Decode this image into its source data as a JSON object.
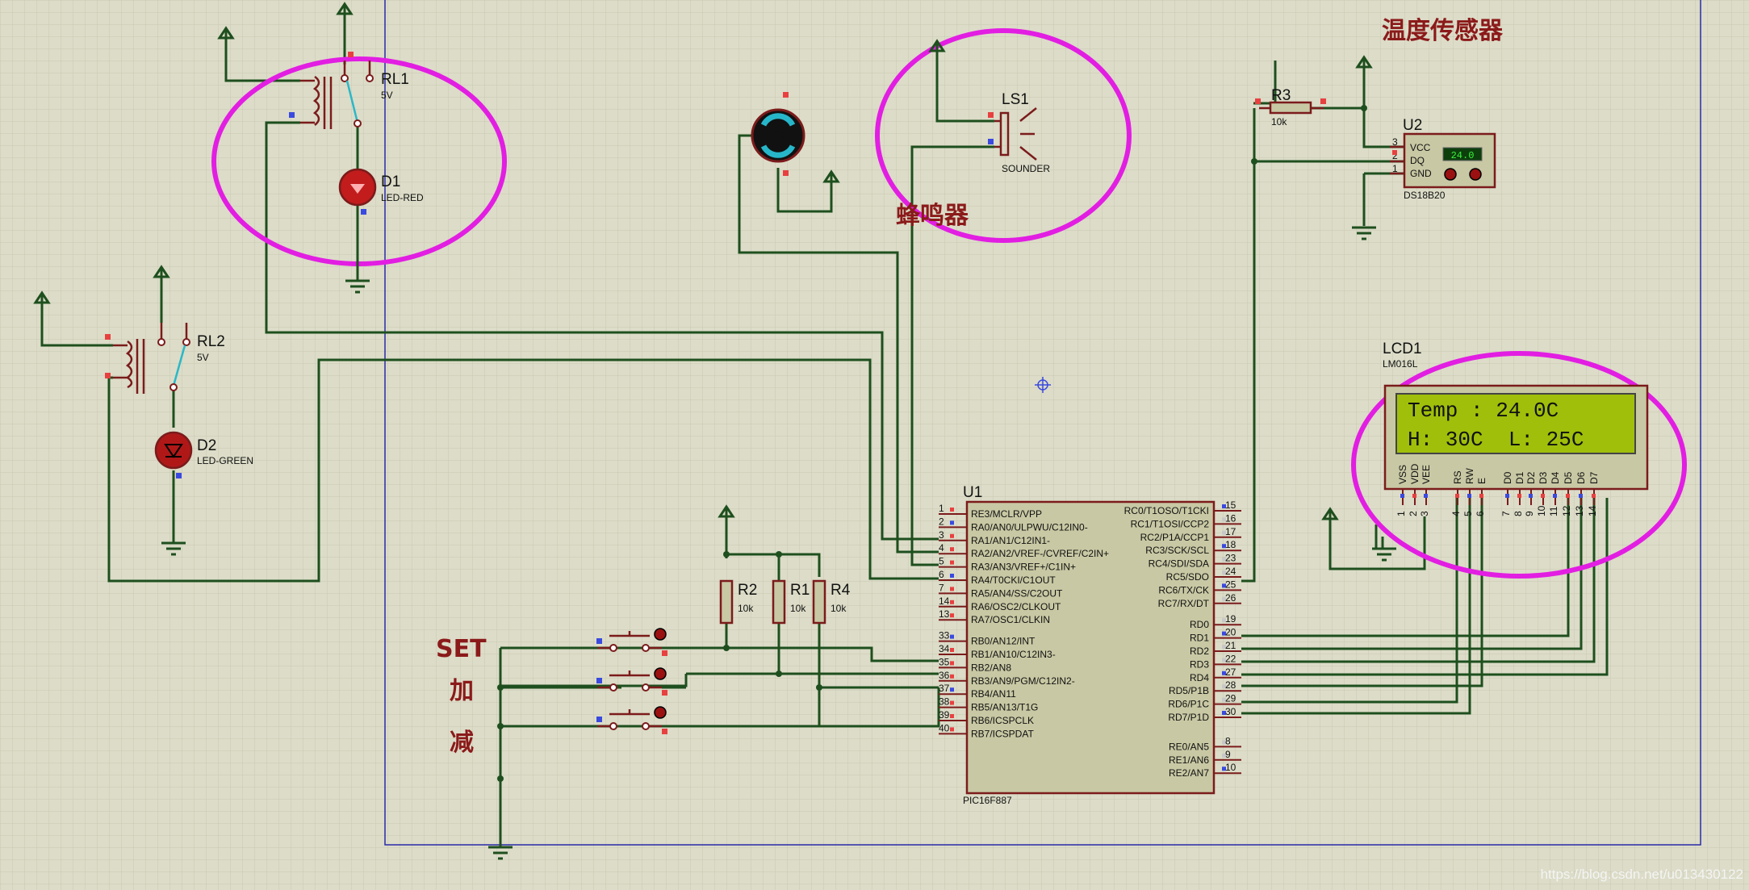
{
  "labels": {
    "temp_sensor_title": "温度传感器",
    "buzzer_title": "蜂鸣器",
    "set_label": "SET",
    "plus_label": "加",
    "minus_label": "减",
    "watermark": "https://blog.csdn.net/u013430122"
  },
  "components": {
    "rl1": {
      "ref": "RL1",
      "value": "5V"
    },
    "rl2": {
      "ref": "RL2",
      "value": "5V"
    },
    "d1": {
      "ref": "D1",
      "value": "LED-RED"
    },
    "d2": {
      "ref": "D2",
      "value": "LED-GREEN"
    },
    "ls1": {
      "ref": "LS1",
      "value": "SOUNDER"
    },
    "r1": {
      "ref": "R1",
      "value": "10k"
    },
    "r2": {
      "ref": "R2",
      "value": "10k"
    },
    "r3": {
      "ref": "R3",
      "value": "10k"
    },
    "r4": {
      "ref": "R4",
      "value": "10k"
    },
    "u1": {
      "ref": "U1",
      "part": "PIC16F887"
    },
    "u2": {
      "ref": "U2",
      "part": "DS18B20",
      "reading": "24.0",
      "pins": [
        "VCC",
        "DQ",
        "GND"
      ],
      "pin_nums": [
        "3",
        "2",
        "1"
      ]
    },
    "lcd1": {
      "ref": "LCD1",
      "part": "LM016L",
      "line1": "Temp : 24.0C",
      "line2": "H: 30C  L: 25C",
      "pins": [
        "VSS",
        "VDD",
        "VEE",
        "RS",
        "RW",
        "E",
        "D0",
        "D1",
        "D2",
        "D3",
        "D4",
        "D5",
        "D6",
        "D7"
      ],
      "pin_nums": [
        "1",
        "2",
        "3",
        "4",
        "5",
        "6",
        "7",
        "8",
        "9",
        "10",
        "11",
        "12",
        "13",
        "14"
      ]
    }
  },
  "u1_left_pins": [
    {
      "num": "1",
      "name": "RE3/MCLR/VPP"
    },
    {
      "num": "2",
      "name": "RA0/AN0/ULPWU/C12IN0-"
    },
    {
      "num": "3",
      "name": "RA1/AN1/C12IN1-"
    },
    {
      "num": "4",
      "name": "RA2/AN2/VREF-/CVREF/C2IN+"
    },
    {
      "num": "5",
      "name": "RA3/AN3/VREF+/C1IN+"
    },
    {
      "num": "6",
      "name": "RA4/T0CKI/C1OUT"
    },
    {
      "num": "7",
      "name": "RA5/AN4/SS/C2OUT"
    },
    {
      "num": "14",
      "name": "RA6/OSC2/CLKOUT"
    },
    {
      "num": "13",
      "name": "RA7/OSC1/CLKIN"
    },
    {
      "num": "33",
      "name": "RB0/AN12/INT"
    },
    {
      "num": "34",
      "name": "RB1/AN10/C12IN3-"
    },
    {
      "num": "35",
      "name": "RB2/AN8"
    },
    {
      "num": "36",
      "name": "RB3/AN9/PGM/C12IN2-"
    },
    {
      "num": "37",
      "name": "RB4/AN11"
    },
    {
      "num": "38",
      "name": "RB5/AN13/T1G"
    },
    {
      "num": "39",
      "name": "RB6/ICSPCLK"
    },
    {
      "num": "40",
      "name": "RB7/ICSPDAT"
    }
  ],
  "u1_right_pins": [
    {
      "num": "15",
      "name": "RC0/T1OSO/T1CKI"
    },
    {
      "num": "16",
      "name": "RC1/T1OSI/CCP2"
    },
    {
      "num": "17",
      "name": "RC2/P1A/CCP1"
    },
    {
      "num": "18",
      "name": "RC3/SCK/SCL"
    },
    {
      "num": "23",
      "name": "RC4/SDI/SDA"
    },
    {
      "num": "24",
      "name": "RC5/SDO"
    },
    {
      "num": "25",
      "name": "RC6/TX/CK"
    },
    {
      "num": "26",
      "name": "RC7/RX/DT"
    },
    {
      "num": "19",
      "name": "RD0"
    },
    {
      "num": "20",
      "name": "RD1"
    },
    {
      "num": "21",
      "name": "RD2"
    },
    {
      "num": "22",
      "name": "RD3"
    },
    {
      "num": "27",
      "name": "RD4"
    },
    {
      "num": "28",
      "name": "RD5/P1B"
    },
    {
      "num": "29",
      "name": "RD6/P1C"
    },
    {
      "num": "30",
      "name": "RD7/P1D"
    },
    {
      "num": "8",
      "name": "RE0/AN5"
    },
    {
      "num": "9",
      "name": "RE1/AN6"
    },
    {
      "num": "10",
      "name": "RE2/AN7"
    }
  ],
  "colors": {
    "background": "#dcdcc8",
    "wire": "#1e4f1e",
    "component": "#7b1b1b",
    "highlight": "#e21ee2",
    "lcd_screen": "#9fbf0a",
    "title_text": "#8b1a1a"
  }
}
